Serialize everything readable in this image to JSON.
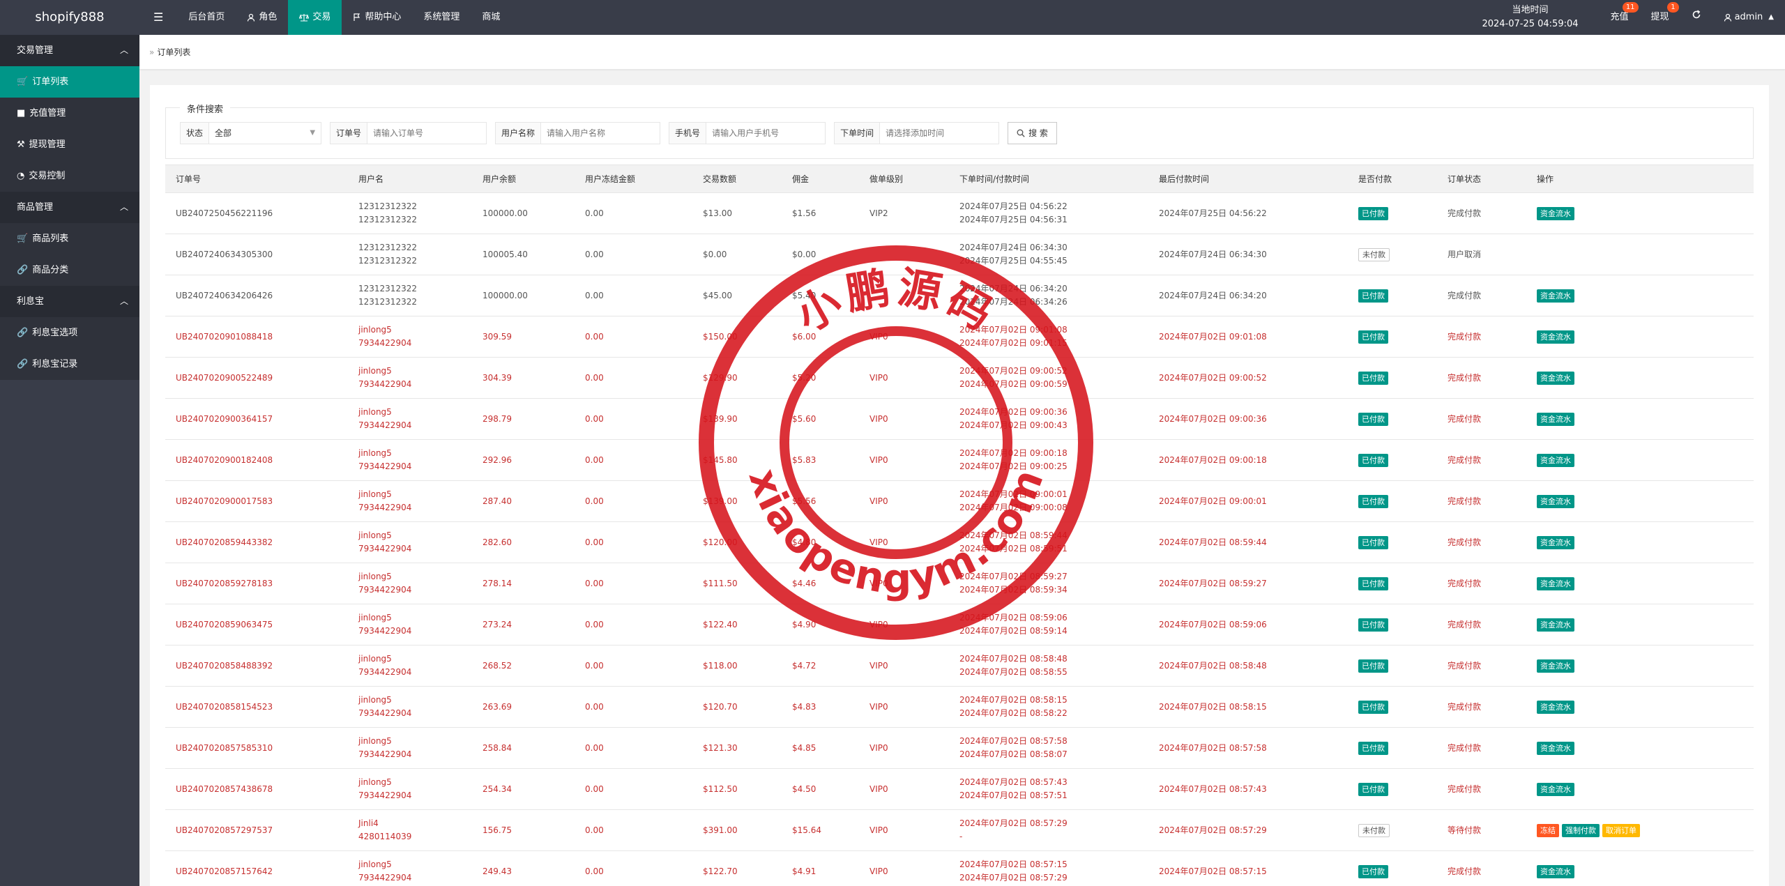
{
  "app": {
    "logo": "shopify888"
  },
  "topnav": [
    {
      "label": "后台首页",
      "icon": ""
    },
    {
      "label": "角色",
      "icon": "user-icon"
    },
    {
      "label": "交易",
      "icon": "scale-icon",
      "active": true
    },
    {
      "label": "帮助中心",
      "icon": "flag-icon"
    },
    {
      "label": "系统管理",
      "icon": ""
    },
    {
      "label": "商城",
      "icon": ""
    }
  ],
  "topright": {
    "time_label": "当地时间",
    "time_value": "2024-07-25 04:59:04",
    "recharge": "充值",
    "recharge_badge": "11",
    "withdraw": "提现",
    "withdraw_badge": "1",
    "user": "admin"
  },
  "sidebar": [
    {
      "type": "group",
      "label": "交易管理"
    },
    {
      "type": "item",
      "label": "订单列表",
      "icon": "cart-icon",
      "active": true
    },
    {
      "type": "item",
      "label": "充值管理",
      "icon": "comment-icon"
    },
    {
      "type": "item",
      "label": "提现管理",
      "icon": "hammer-icon"
    },
    {
      "type": "item",
      "label": "交易控制",
      "icon": "gauge-icon"
    },
    {
      "type": "group",
      "label": "商品管理"
    },
    {
      "type": "item",
      "label": "商品列表",
      "icon": "cart-icon"
    },
    {
      "type": "item",
      "label": "商品分类",
      "icon": "link-icon"
    },
    {
      "type": "group",
      "label": "利息宝"
    },
    {
      "type": "item",
      "label": "利息宝选项",
      "icon": "link-icon"
    },
    {
      "type": "item",
      "label": "利息宝记录",
      "icon": "link-icon"
    }
  ],
  "breadcrumb": "订单列表",
  "search": {
    "legend": "条件搜索",
    "status_label": "状态",
    "status_value": "全部",
    "order_label": "订单号",
    "order_placeholder": "请输入订单号",
    "username_label": "用户名称",
    "username_placeholder": "请输入用户名称",
    "phone_label": "手机号",
    "phone_placeholder": "请输入用户手机号",
    "time_label": "下单时间",
    "time_placeholder": "请选择添加时间",
    "button": "搜 索"
  },
  "table": {
    "headers": [
      "订单号",
      "用户名",
      "用户余额",
      "用户冻结金额",
      "交易数额",
      "佣金",
      "做单级别",
      "下单时间/付款时间",
      "最后付款时间",
      "是否付款",
      "订单状态",
      "操作"
    ],
    "rows": [
      {
        "style": "normal",
        "order": "UB2407250456221196",
        "user1": "12312312322",
        "user2": "12312312322",
        "balance": "100000.00",
        "frozen": "0.00",
        "amount": "$13.00",
        "commission": "$1.56",
        "level": "VIP2",
        "t1": "2024年07月25日 04:56:22",
        "t2": "2024年07月25日 04:56:31",
        "last": "2024年07月25日 04:56:22",
        "paid": "已付款",
        "paid_style": "green",
        "status": "完成付款",
        "actions": [
          "资金流水"
        ]
      },
      {
        "style": "normal",
        "order": "UB2407240634305300",
        "user1": "12312312322",
        "user2": "12312312322",
        "balance": "100005.40",
        "frozen": "0.00",
        "amount": "$0.00",
        "commission": "$0.00",
        "level": "",
        "t1": "2024年07月24日 06:34:30",
        "t2": "2024年07月25日 04:55:45",
        "last": "2024年07月24日 06:34:30",
        "paid": "未付款",
        "paid_style": "outline",
        "status": "用户取消",
        "actions": []
      },
      {
        "style": "normal",
        "order": "UB2407240634206426",
        "user1": "12312312322",
        "user2": "12312312322",
        "balance": "100000.00",
        "frozen": "0.00",
        "amount": "$45.00",
        "commission": "$5.40",
        "level": "",
        "t1": "2024年07月24日 06:34:20",
        "t2": "2024年07月24日 06:34:26",
        "last": "2024年07月24日 06:34:20",
        "paid": "已付款",
        "paid_style": "green",
        "status": "完成付款",
        "actions": [
          "资金流水"
        ]
      },
      {
        "style": "red",
        "order": "UB2407020901088418",
        "user1": "jinlong5",
        "user2": "7934422904",
        "balance": "309.59",
        "frozen": "0.00",
        "amount": "$150.00",
        "commission": "$6.00",
        "level": "VIP0",
        "t1": "2024年07月02日 09:01:08",
        "t2": "2024年07月02日 09:01:15",
        "last": "2024年07月02日 09:01:08",
        "paid": "已付款",
        "paid_style": "green",
        "status": "完成付款",
        "actions": [
          "资金流水"
        ]
      },
      {
        "style": "red",
        "order": "UB2407020900522489",
        "user1": "jinlong5",
        "user2": "7934422904",
        "balance": "304.39",
        "frozen": "0.00",
        "amount": "$129.90",
        "commission": "$5.20",
        "level": "VIP0",
        "t1": "2024年07月02日 09:00:52",
        "t2": "2024年07月02日 09:00:59",
        "last": "2024年07月02日 09:00:52",
        "paid": "已付款",
        "paid_style": "green",
        "status": "完成付款",
        "actions": [
          "资金流水"
        ]
      },
      {
        "style": "red",
        "order": "UB2407020900364157",
        "user1": "jinlong5",
        "user2": "7934422904",
        "balance": "298.79",
        "frozen": "0.00",
        "amount": "$139.90",
        "commission": "$5.60",
        "level": "VIP0",
        "t1": "2024年07月02日 09:00:36",
        "t2": "2024年07月02日 09:00:43",
        "last": "2024年07月02日 09:00:36",
        "paid": "已付款",
        "paid_style": "green",
        "status": "完成付款",
        "actions": [
          "资金流水"
        ]
      },
      {
        "style": "red",
        "order": "UB2407020900182408",
        "user1": "jinlong5",
        "user2": "7934422904",
        "balance": "292.96",
        "frozen": "0.00",
        "amount": "$145.80",
        "commission": "$5.83",
        "level": "VIP0",
        "t1": "2024年07月02日 09:00:18",
        "t2": "2024年07月02日 09:00:25",
        "last": "2024年07月02日 09:00:18",
        "paid": "已付款",
        "paid_style": "green",
        "status": "完成付款",
        "actions": [
          "资金流水"
        ]
      },
      {
        "style": "red",
        "order": "UB2407020900017583",
        "user1": "jinlong5",
        "user2": "7934422904",
        "balance": "287.40",
        "frozen": "0.00",
        "amount": "$139.00",
        "commission": "$5.56",
        "level": "VIP0",
        "t1": "2024年07月02日 09:00:01",
        "t2": "2024年07月02日 09:00:08",
        "last": "2024年07月02日 09:00:01",
        "paid": "已付款",
        "paid_style": "green",
        "status": "完成付款",
        "actions": [
          "资金流水"
        ]
      },
      {
        "style": "red",
        "order": "UB2407020859443382",
        "user1": "jinlong5",
        "user2": "7934422904",
        "balance": "282.60",
        "frozen": "0.00",
        "amount": "$120.00",
        "commission": "$4.80",
        "level": "VIP0",
        "t1": "2024年07月02日 08:59:44",
        "t2": "2024年07月02日 08:59:51",
        "last": "2024年07月02日 08:59:44",
        "paid": "已付款",
        "paid_style": "green",
        "status": "完成付款",
        "actions": [
          "资金流水"
        ]
      },
      {
        "style": "red",
        "order": "UB2407020859278183",
        "user1": "jinlong5",
        "user2": "7934422904",
        "balance": "278.14",
        "frozen": "0.00",
        "amount": "$111.50",
        "commission": "$4.46",
        "level": "VIP0",
        "t1": "2024年07月02日 08:59:27",
        "t2": "2024年07月02日 08:59:34",
        "last": "2024年07月02日 08:59:27",
        "paid": "已付款",
        "paid_style": "green",
        "status": "完成付款",
        "actions": [
          "资金流水"
        ]
      },
      {
        "style": "red",
        "order": "UB2407020859063475",
        "user1": "jinlong5",
        "user2": "7934422904",
        "balance": "273.24",
        "frozen": "0.00",
        "amount": "$122.40",
        "commission": "$4.90",
        "level": "VIP0",
        "t1": "2024年07月02日 08:59:06",
        "t2": "2024年07月02日 08:59:14",
        "last": "2024年07月02日 08:59:06",
        "paid": "已付款",
        "paid_style": "green",
        "status": "完成付款",
        "actions": [
          "资金流水"
        ]
      },
      {
        "style": "red",
        "order": "UB2407020858488392",
        "user1": "jinlong5",
        "user2": "7934422904",
        "balance": "268.52",
        "frozen": "0.00",
        "amount": "$118.00",
        "commission": "$4.72",
        "level": "VIP0",
        "t1": "2024年07月02日 08:58:48",
        "t2": "2024年07月02日 08:58:55",
        "last": "2024年07月02日 08:58:48",
        "paid": "已付款",
        "paid_style": "green",
        "status": "完成付款",
        "actions": [
          "资金流水"
        ]
      },
      {
        "style": "red",
        "order": "UB2407020858154523",
        "user1": "jinlong5",
        "user2": "7934422904",
        "balance": "263.69",
        "frozen": "0.00",
        "amount": "$120.70",
        "commission": "$4.83",
        "level": "VIP0",
        "t1": "2024年07月02日 08:58:15",
        "t2": "2024年07月02日 08:58:22",
        "last": "2024年07月02日 08:58:15",
        "paid": "已付款",
        "paid_style": "green",
        "status": "完成付款",
        "actions": [
          "资金流水"
        ]
      },
      {
        "style": "red",
        "order": "UB2407020857585310",
        "user1": "jinlong5",
        "user2": "7934422904",
        "balance": "258.84",
        "frozen": "0.00",
        "amount": "$121.30",
        "commission": "$4.85",
        "level": "VIP0",
        "t1": "2024年07月02日 08:57:58",
        "t2": "2024年07月02日 08:58:07",
        "last": "2024年07月02日 08:57:58",
        "paid": "已付款",
        "paid_style": "green",
        "status": "完成付款",
        "actions": [
          "资金流水"
        ]
      },
      {
        "style": "red",
        "order": "UB2407020857438678",
        "user1": "jinlong5",
        "user2": "7934422904",
        "balance": "254.34",
        "frozen": "0.00",
        "amount": "$112.50",
        "commission": "$4.50",
        "level": "VIP0",
        "t1": "2024年07月02日 08:57:43",
        "t2": "2024年07月02日 08:57:51",
        "last": "2024年07月02日 08:57:43",
        "paid": "已付款",
        "paid_style": "green",
        "status": "完成付款",
        "actions": [
          "资金流水"
        ]
      },
      {
        "style": "red",
        "order": "UB2407020857297537",
        "user1": "Jinli4",
        "user2": "4280114039",
        "balance": "156.75",
        "frozen": "0.00",
        "amount": "$391.00",
        "commission": "$15.64",
        "level": "VIP0",
        "t1": "2024年07月02日 08:57:29",
        "t2": "-",
        "last": "2024年07月02日 08:57:29",
        "paid": "未付款",
        "paid_style": "outline",
        "status": "等待付款",
        "actions": [
          "冻结",
          "强制付款",
          "取消订单"
        ]
      },
      {
        "style": "red",
        "order": "UB2407020857157642",
        "user1": "jinlong5",
        "user2": "7934422904",
        "balance": "249.43",
        "frozen": "0.00",
        "amount": "$122.70",
        "commission": "$4.91",
        "level": "VIP0",
        "t1": "2024年07月02日 08:57:15",
        "t2": "2024年07月02日 08:57:29",
        "last": "2024年07月02日 08:57:15",
        "paid": "已付款",
        "paid_style": "green",
        "status": "完成付款",
        "actions": [
          "资金流水"
        ]
      }
    ]
  },
  "stamp": {
    "top_text": "小鹏源码",
    "bottom_text": "xiaopengym.com",
    "color": "#d6141c"
  }
}
